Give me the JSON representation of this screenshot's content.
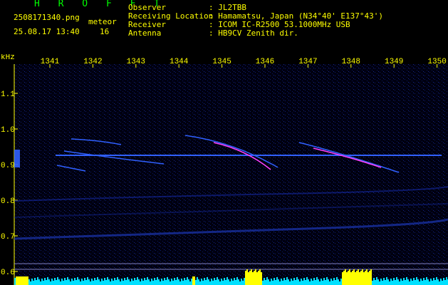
{
  "header": {
    "app_title": "H R O F F T",
    "filename": "2508171340.png",
    "datetime": "25.08.17 13:40",
    "meteor_label": "meteor",
    "meteor_count": "16",
    "fields": [
      {
        "label": "Observer",
        "value": ": JL2TBB"
      },
      {
        "label": "Receiving Location",
        "value": ": Hamamatsu, Japan (N34°40' E137°43')"
      },
      {
        "label": "Receiver",
        "value": ": ICOM IC-R2500 53.1000MHz USB"
      },
      {
        "label": "Antenna",
        "value": ": HB9CV Zenith dir."
      }
    ]
  },
  "spectrogram": {
    "y_unit": "kHz",
    "x_ticks": [
      "1341",
      "1342",
      "1343",
      "1344",
      "1345",
      "1346",
      "1347",
      "1348",
      "1349",
      "1350"
    ],
    "y_ticks": [
      "1.1",
      "1.0",
      "0.9",
      "0.8",
      "0.7",
      "0.6"
    ],
    "colors": {
      "background": "#000010",
      "axis_text": "#ffff00",
      "carrier": "#3060ff",
      "signal": "#ff40ff",
      "level": "#00e0ff",
      "level_peak": "#ffff00"
    }
  }
}
